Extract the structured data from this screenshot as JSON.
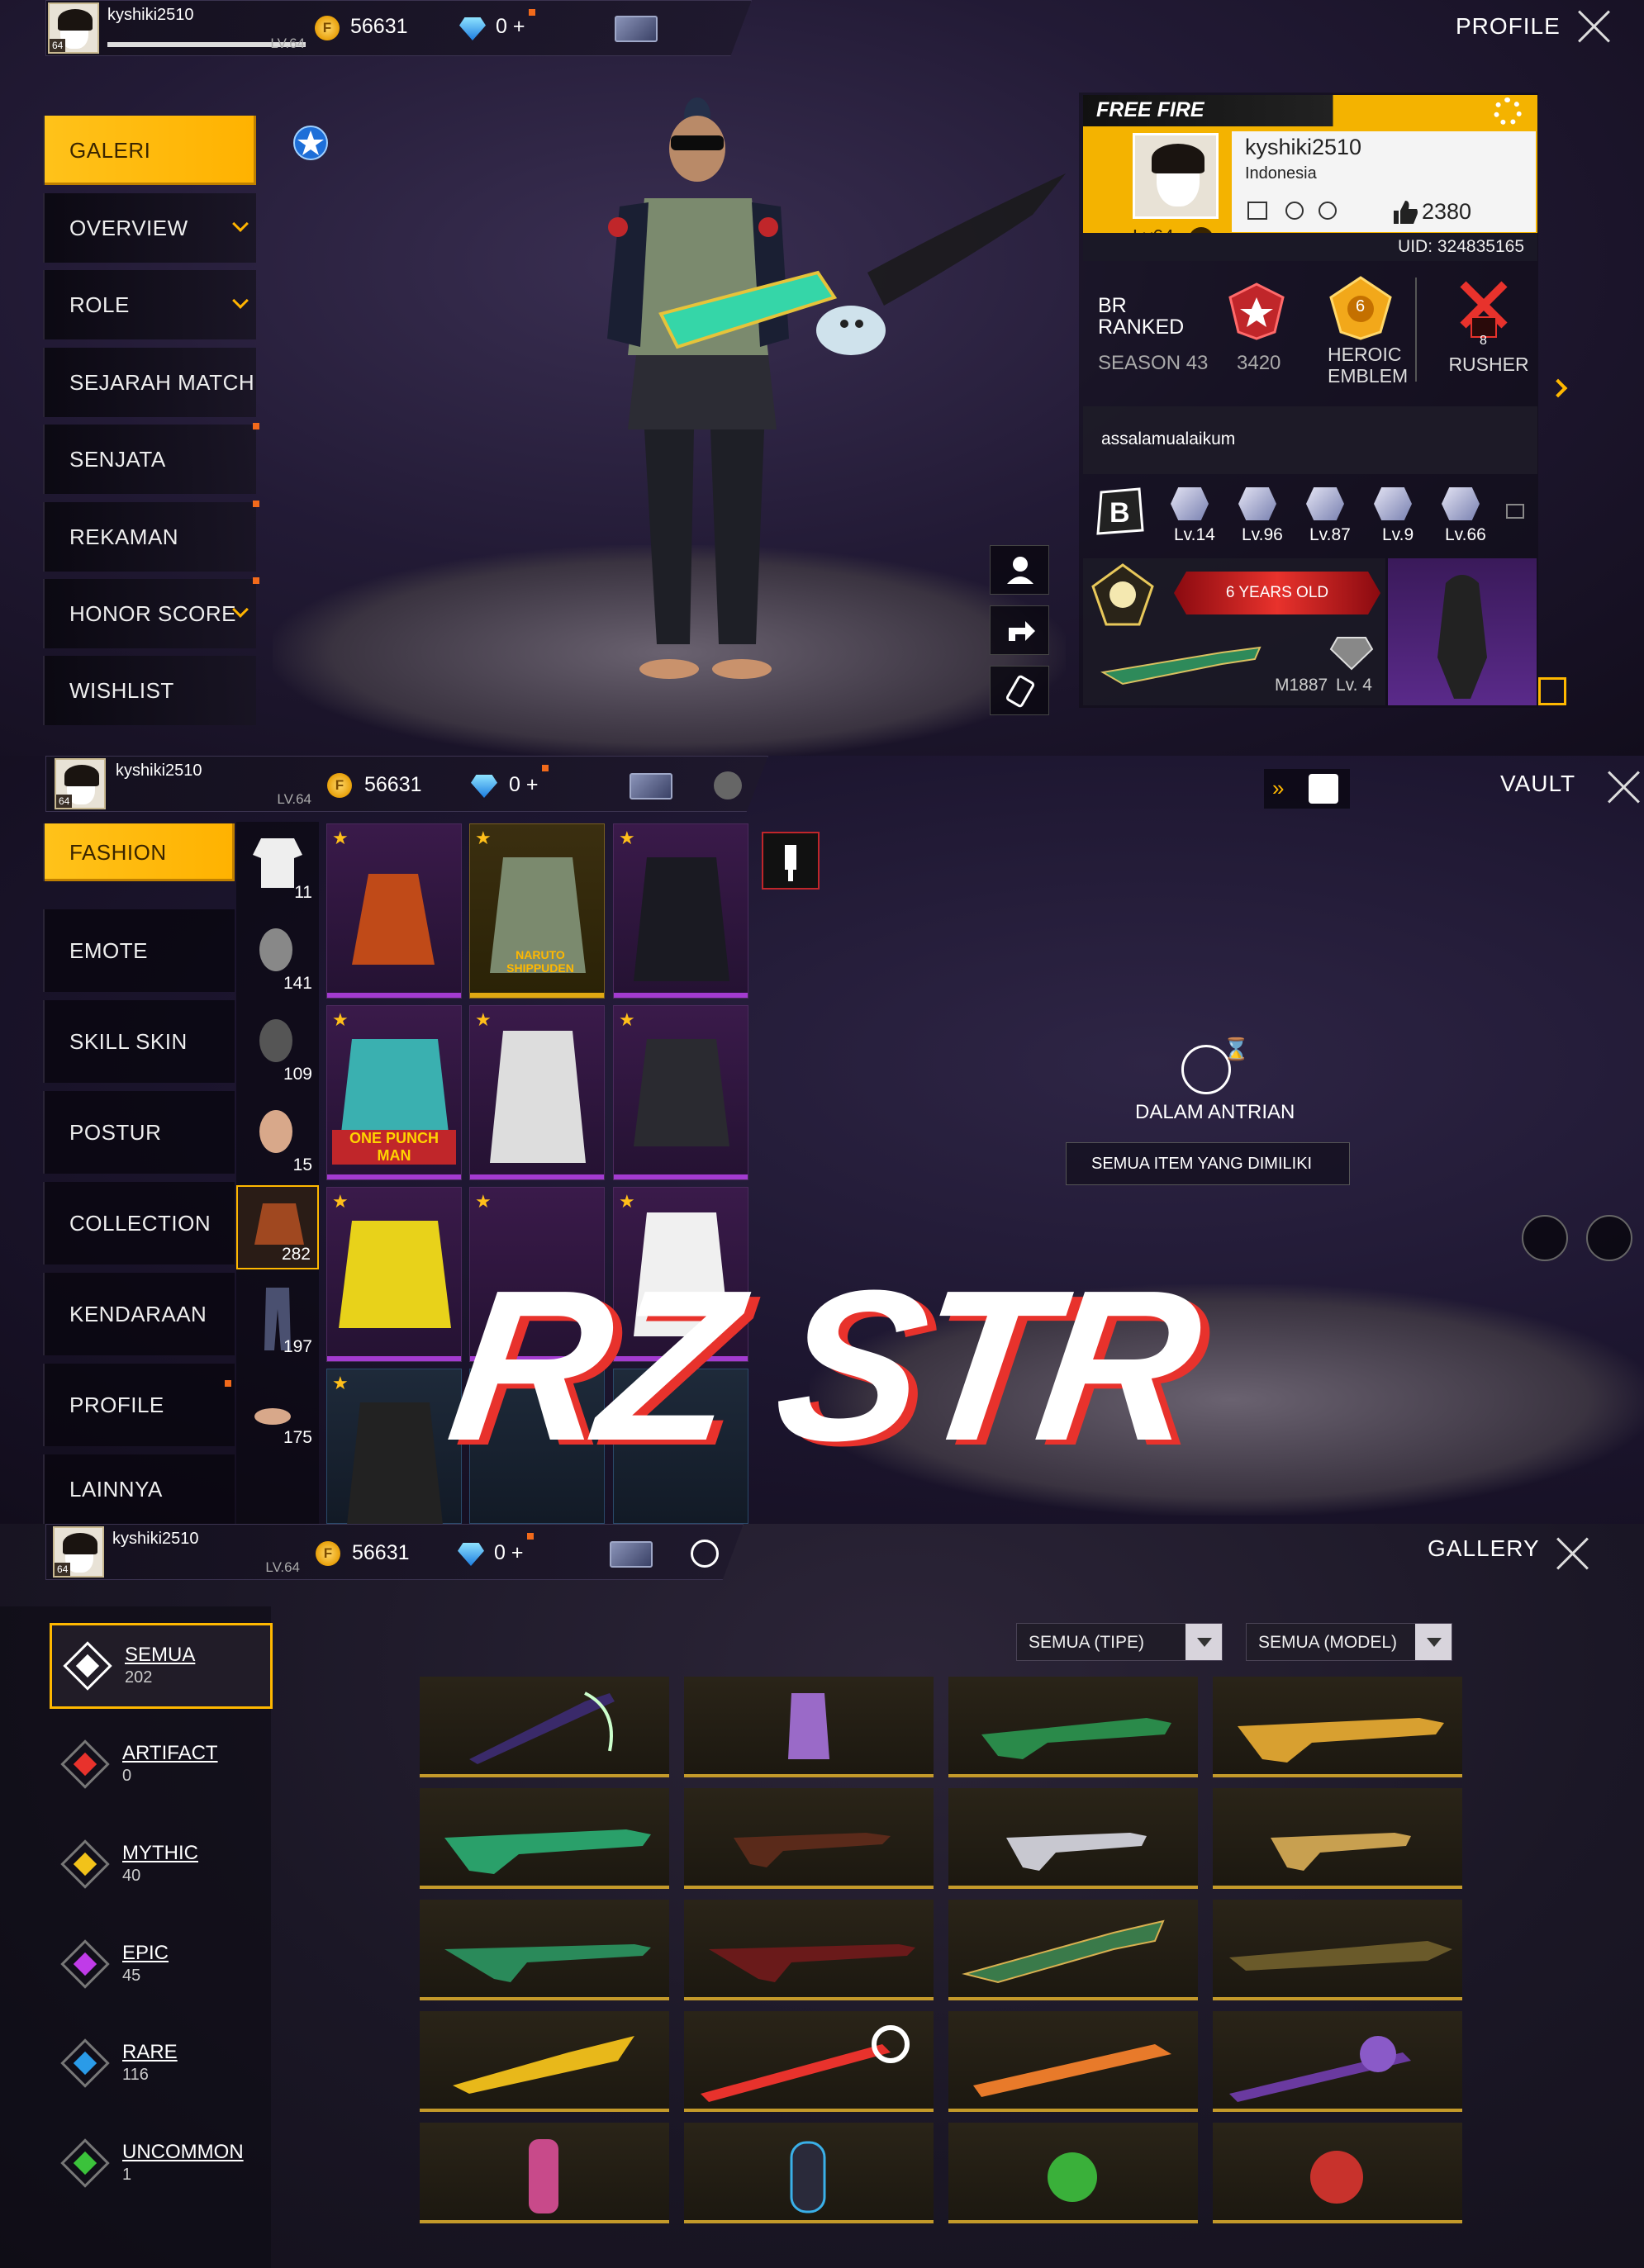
{
  "profile_screen": {
    "user": {
      "name": "kyshiki2510",
      "level": "LV.64",
      "badge": "64"
    },
    "currency": {
      "gold": "56631",
      "diamonds": "0 +"
    },
    "title": "PROFILE",
    "menu": [
      "GALERI",
      "OVERVIEW",
      "ROLE",
      "SEJARAH MATCH",
      "SENJATA",
      "REKAMAN",
      "HONOR SCORE",
      "WISHLIST"
    ],
    "card": {
      "logo": "FREE FIRE",
      "name": "kyshiki2510",
      "country": "Indonesia",
      "level": "Lv64",
      "likes": "2380",
      "uid": "UID: 324835165",
      "mode": "BR",
      "mode2": "RANKED",
      "season": "SEASON 43",
      "points": "3420",
      "emblem": "HEROIC",
      "emblem2": "EMBLEM",
      "rusher": "RUSHER",
      "rusher_num": "8",
      "emblem_num": "6",
      "bio": "assalamualaikum",
      "levels": [
        "Lv.14",
        "Lv.96",
        "Lv.87",
        "Lv.9",
        "Lv.66"
      ],
      "years": "6 YEARS OLD",
      "weapon": "M1887",
      "weapon_lv": "Lv. 4"
    }
  },
  "vault_screen": {
    "user": {
      "name": "kyshiki2510",
      "level": "LV.64",
      "badge": "64"
    },
    "currency": {
      "gold": "56631",
      "diamonds": "0 +"
    },
    "title": "VAULT",
    "menu": [
      "FASHION",
      "EMOTE",
      "SKILL SKIN",
      "POSTUR",
      "COLLECTION",
      "KENDARAAN",
      "PROFILE",
      "LAINNYA"
    ],
    "categories": [
      "11",
      "141",
      "109",
      "15",
      "282",
      "197",
      "175"
    ],
    "tile_labels": [
      "NARUTO SHIPPUDEN",
      "ONE PUNCH MAN"
    ],
    "queue_label": "DALAM ANTRIAN",
    "all_items": "SEMUA ITEM YANG DIMILIKI",
    "watermark": "RZ STR"
  },
  "gallery_screen": {
    "user": {
      "name": "kyshiki2510",
      "level": "LV.64",
      "badge": "64"
    },
    "currency": {
      "gold": "56631",
      "diamonds": "0 +"
    },
    "title": "GALLERY",
    "filter_type": "SEMUA (TIPE)",
    "filter_model": "SEMUA (MODEL)",
    "rarities": [
      {
        "name": "SEMUA",
        "count": "202",
        "color": "#ffffff"
      },
      {
        "name": "ARTIFACT",
        "count": "0",
        "color": "#e8322c"
      },
      {
        "name": "MYTHIC",
        "count": "40",
        "color": "#f2c21a"
      },
      {
        "name": "EPIC",
        "count": "45",
        "color": "#c03be8"
      },
      {
        "name": "RARE",
        "count": "116",
        "color": "#2a9be8"
      },
      {
        "name": "UNCOMMON",
        "count": "1",
        "color": "#3bc23b"
      }
    ]
  },
  "colors": {
    "accent": "#ffb800",
    "highlight": "#f26a1b",
    "purple": "#a33bd0"
  }
}
